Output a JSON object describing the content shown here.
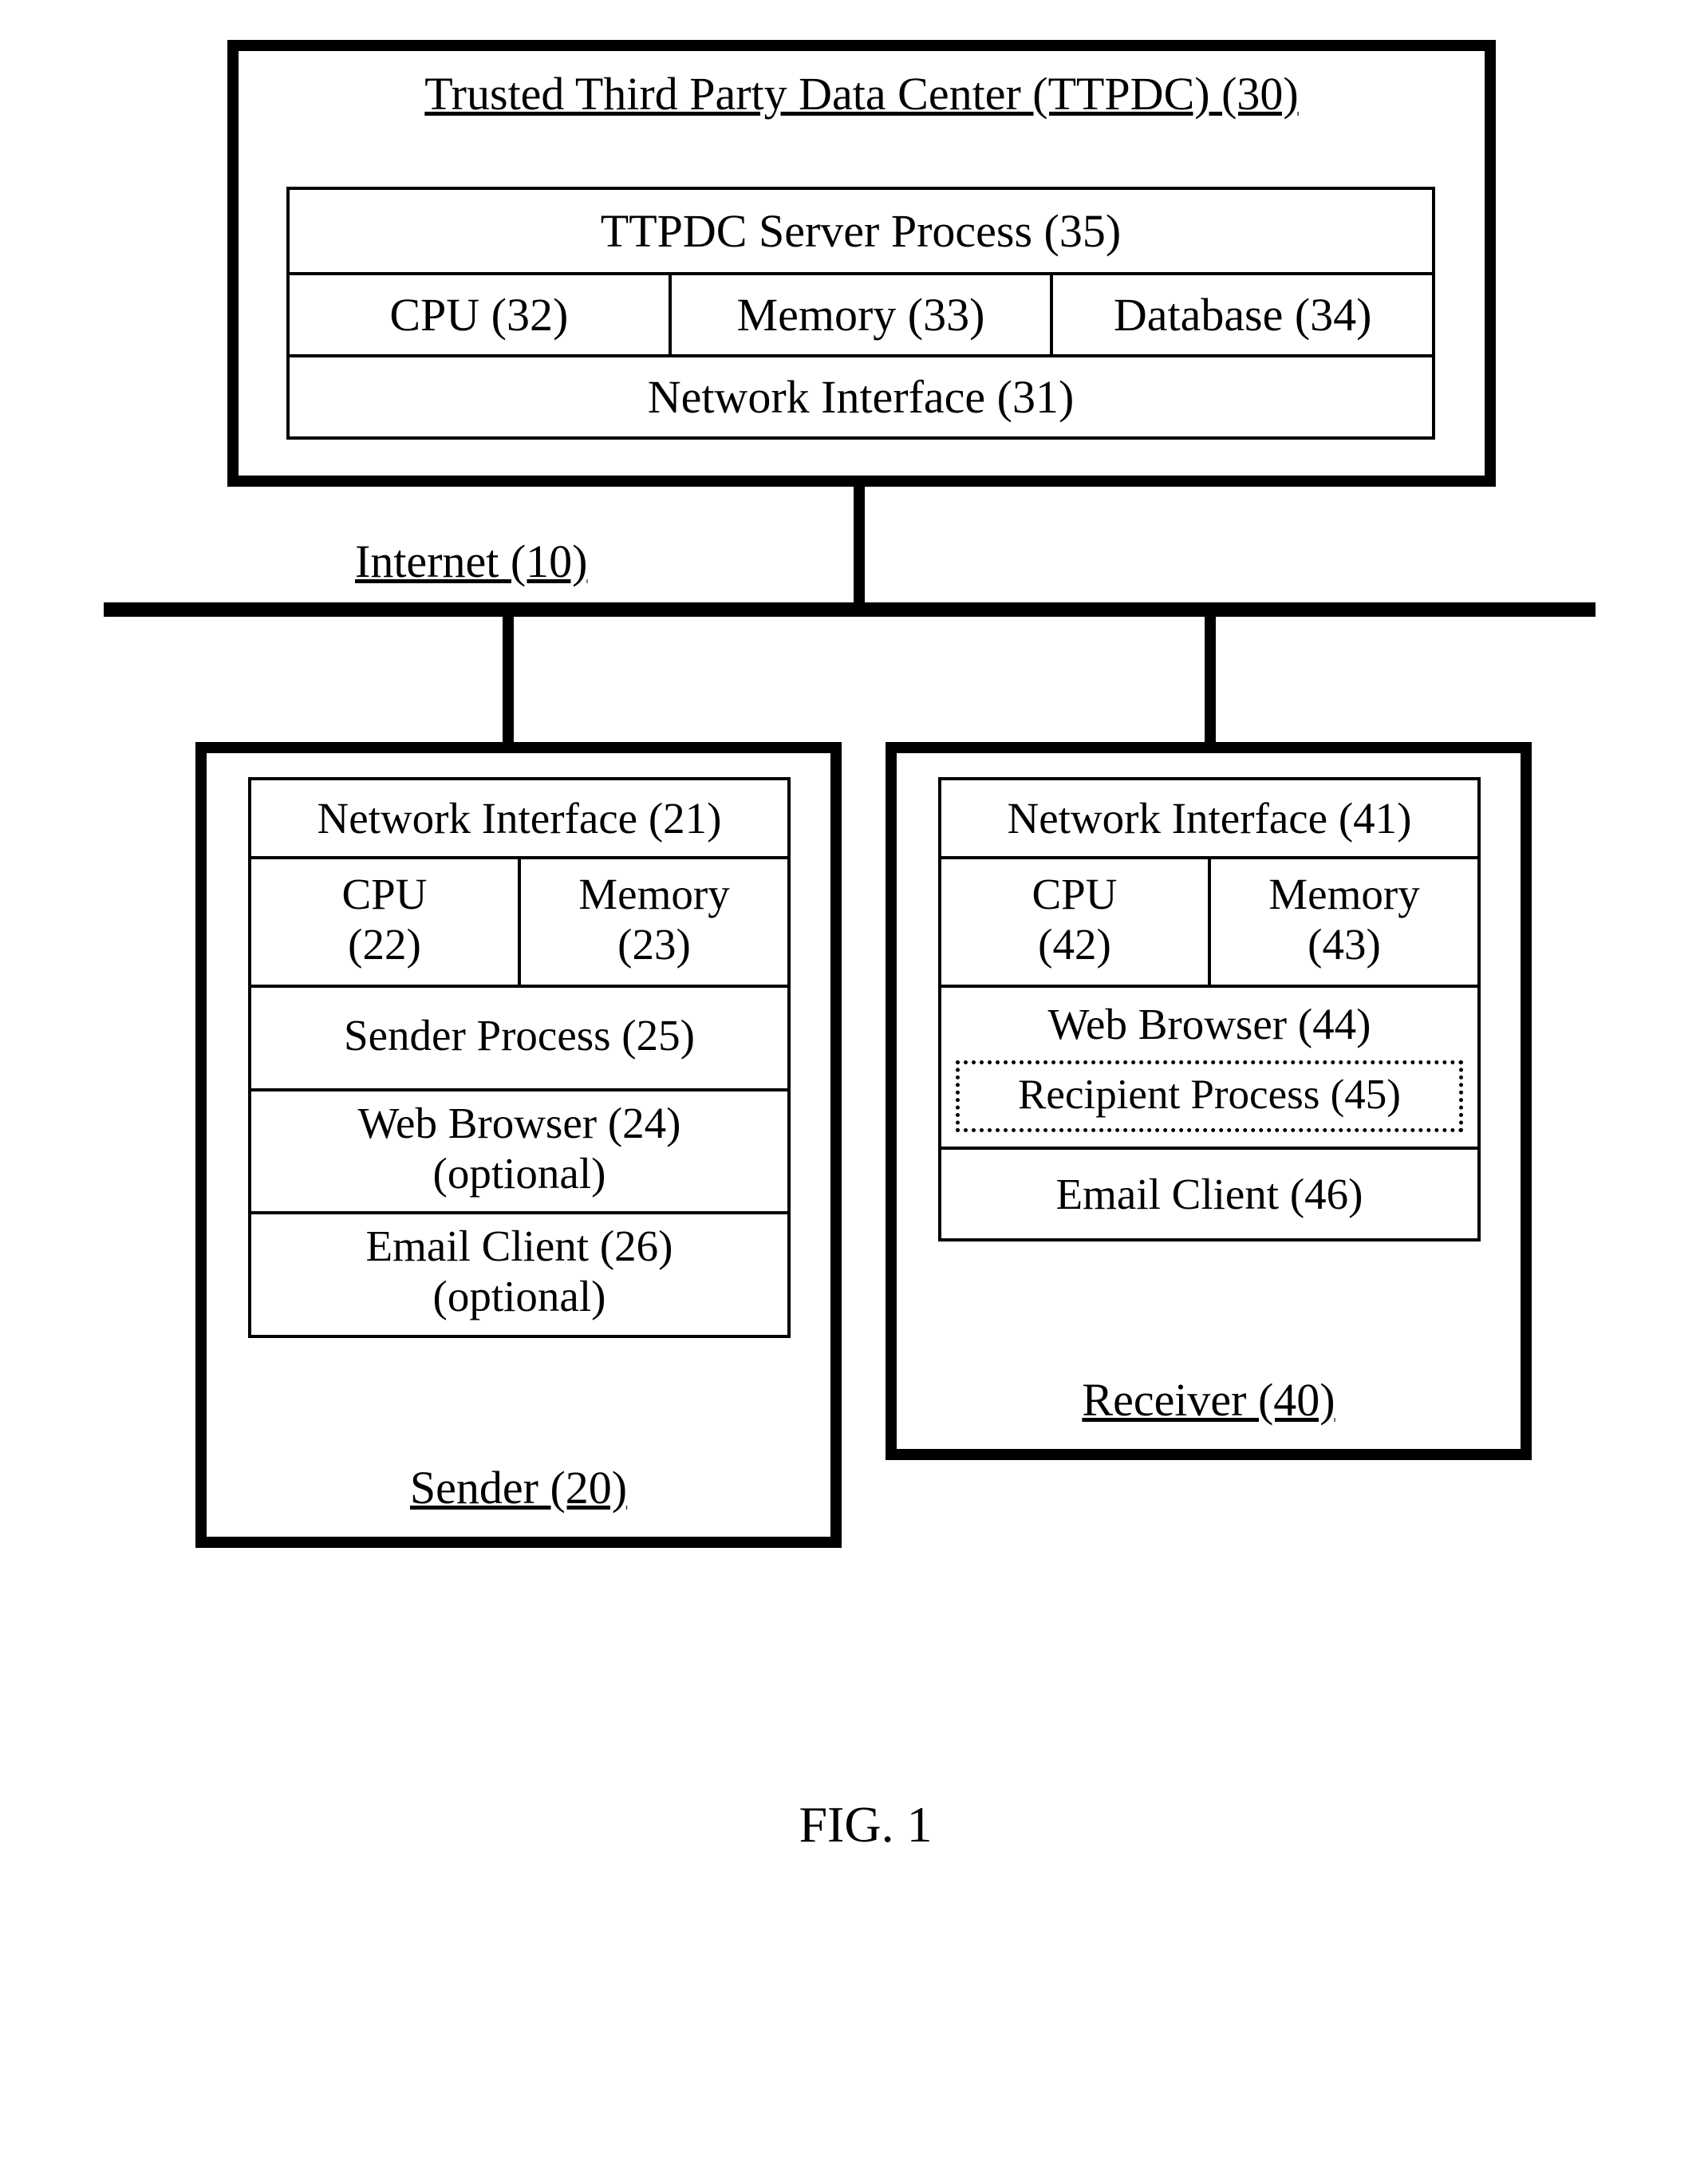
{
  "top": {
    "title": "Trusted Third Party Data Center (TTPDC) (30)",
    "server_process": "TTPDC Server Process (35)",
    "cpu": "CPU (32)",
    "memory": "Memory (33)",
    "database": "Database (34)",
    "network_interface": "Network Interface (31)"
  },
  "internet_label": "Internet (10)",
  "sender": {
    "network_interface": "Network Interface (21)",
    "cpu_line1": "CPU",
    "cpu_line2": "(22)",
    "memory_line1": "Memory",
    "memory_line2": "(23)",
    "sender_process": "Sender Process (25)",
    "web_browser_line1": "Web Browser (24)",
    "web_browser_line2": "(optional)",
    "email_client_line1": "Email Client (26)",
    "email_client_line2": "(optional)",
    "title": "Sender (20)"
  },
  "receiver": {
    "network_interface": "Network Interface (41)",
    "cpu_line1": "CPU",
    "cpu_line2": "(42)",
    "memory_line1": "Memory",
    "memory_line2": "(43)",
    "web_browser": "Web Browser (44)",
    "recipient_process": "Recipient Process (45)",
    "email_client": "Email Client (46)",
    "title": "Receiver (40)"
  },
  "figure_label": "FIG. 1"
}
